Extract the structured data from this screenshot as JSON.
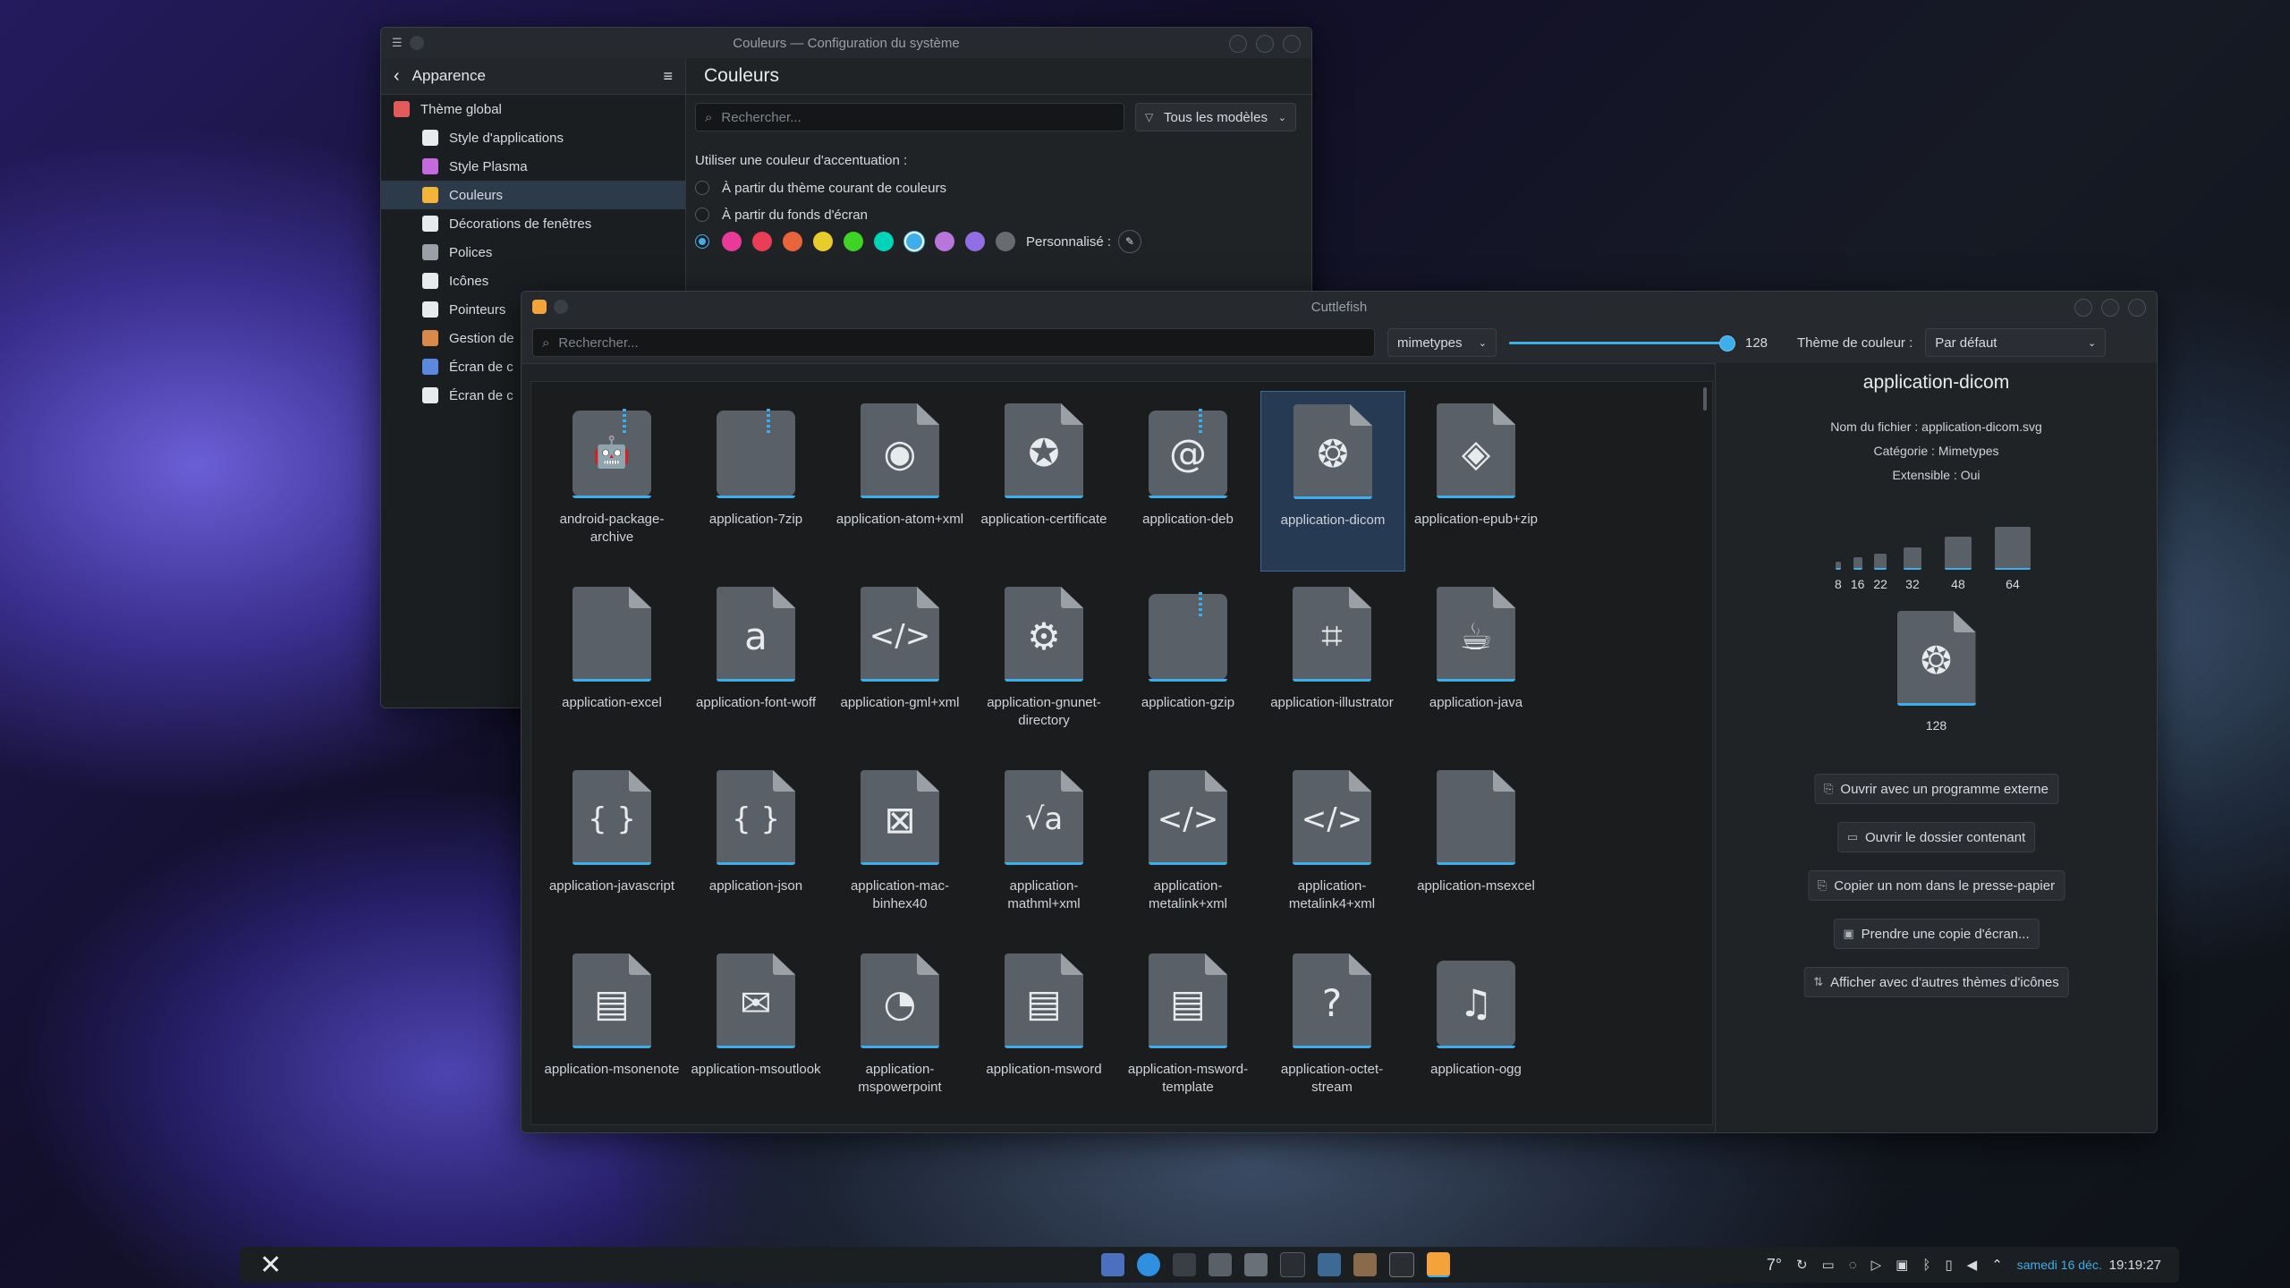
{
  "settings": {
    "title": "Couleurs — Configuration du système",
    "sidebar": {
      "header": "Apparence",
      "items": [
        {
          "label": "Thème global",
          "color": "#e25a5a"
        },
        {
          "label": "Style d'applications",
          "color": "#e8ebee"
        },
        {
          "label": "Style Plasma",
          "color": "#c46adf"
        },
        {
          "label": "Couleurs",
          "color": "#f4b43a"
        },
        {
          "label": "Décorations de fenêtres",
          "color": "#e8ebee"
        },
        {
          "label": "Polices",
          "color": "#9aa0a6"
        },
        {
          "label": "Icônes",
          "color": "#e8ebee"
        },
        {
          "label": "Pointeurs",
          "color": "#e8ebee"
        },
        {
          "label": "Gestion de",
          "color": "#d98a4a"
        },
        {
          "label": "Écran de c",
          "color": "#5a8adf"
        },
        {
          "label": "Écran de c",
          "color": "#e8ebee"
        }
      ]
    },
    "main": {
      "title": "Couleurs",
      "search_placeholder": "Rechercher...",
      "filter": "Tous les modèles",
      "accent_heading": "Utiliser une couleur d'accentuation :",
      "option_theme": "À partir du thème courant de couleurs",
      "option_wallpaper": "À partir du fonds d'écran",
      "custom_label": "Personnalisé :",
      "swatches": [
        "#e93a9a",
        "#e93d58",
        "#e9643a",
        "#e8cb2d",
        "#3dd425",
        "#00d3b8",
        "#3daee9",
        "#b875dc",
        "#926ee4",
        "#686b6f"
      ]
    }
  },
  "cuttlefish": {
    "title": "Cuttlefish",
    "toolbar": {
      "search_placeholder": "Rechercher...",
      "category": "mimetypes",
      "size_value": "128",
      "slider_fraction": 0.97,
      "theme_label": "Thème de couleur :",
      "theme_value": "Par défaut"
    },
    "icons": [
      {
        "label": "android-package-archive",
        "glyph": "🤖",
        "zip": true
      },
      {
        "label": "application-7zip",
        "glyph": "",
        "zip": true
      },
      {
        "label": "application-atom+xml",
        "glyph": "◉"
      },
      {
        "label": "application-certificate",
        "glyph": "✪"
      },
      {
        "label": "application-deb",
        "glyph": "@",
        "zip": true
      },
      {
        "label": "application-dicom",
        "glyph": "❂",
        "selected": true
      },
      {
        "label": "application-epub+zip",
        "glyph": "◈"
      },
      {
        "label": "application-excel",
        "glyph": ""
      },
      {
        "label": "application-font-woff",
        "glyph": "a"
      },
      {
        "label": "application-gml+xml",
        "glyph": "</>"
      },
      {
        "label": "application-gnunet-directory",
        "glyph": "⚙"
      },
      {
        "label": "application-gzip",
        "glyph": "",
        "zip": true
      },
      {
        "label": "application-illustrator",
        "glyph": "⌗"
      },
      {
        "label": "application-java",
        "glyph": "☕"
      },
      {
        "label": "application-javascript",
        "glyph": "{ }"
      },
      {
        "label": "application-json",
        "glyph": "{ }"
      },
      {
        "label": "application-mac-binhex40",
        "glyph": "⊠"
      },
      {
        "label": "application-mathml+xml",
        "glyph": "√a"
      },
      {
        "label": "application-metalink+xml",
        "glyph": "</>"
      },
      {
        "label": "application-metalink4+xml",
        "glyph": "</>"
      },
      {
        "label": "application-msexcel",
        "glyph": ""
      },
      {
        "label": "application-msonenote",
        "glyph": "▤"
      },
      {
        "label": "application-msoutlook",
        "glyph": "✉"
      },
      {
        "label": "application-mspowerpoint",
        "glyph": "◔"
      },
      {
        "label": "application-msword",
        "glyph": "▤"
      },
      {
        "label": "application-msword-template",
        "glyph": "▤"
      },
      {
        "label": "application-octet-stream",
        "glyph": "?"
      },
      {
        "label": "application-ogg",
        "glyph": "♫"
      }
    ],
    "details": {
      "name": "application-dicom",
      "filename_label": "Nom du fichier :",
      "filename": "application-dicom.svg",
      "category_label": "Catégorie :",
      "category": "Mimetypes",
      "scalable_label": "Extensible :",
      "scalable": "Oui",
      "sizes": [
        "8",
        "16",
        "22",
        "32",
        "48",
        "64"
      ],
      "large_size": "128",
      "buttons": [
        "Ouvrir avec un programme externe",
        "Ouvrir le dossier contenant",
        "Copier un nom dans le presse-papier",
        "Prendre une copie d'écran...",
        "Afficher avec d'autres thèmes d'icônes"
      ]
    }
  },
  "taskbar": {
    "temperature": "7°",
    "date": "samedi 16 déc.",
    "time": "19:19:27"
  }
}
